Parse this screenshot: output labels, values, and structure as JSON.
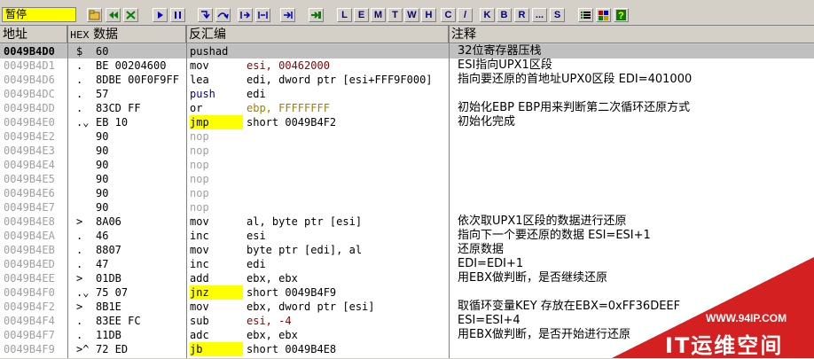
{
  "toolbar": {
    "status": "暂停",
    "letters": [
      "L",
      "E",
      "M",
      "T",
      "W",
      "H",
      "C",
      "/",
      "K",
      "B",
      "R",
      "...",
      "S"
    ]
  },
  "header": {
    "addr": "地址",
    "hex_prefix": "HEX",
    "hex": "数据",
    "disasm": "反汇编",
    "comment": "注释"
  },
  "rows": [
    {
      "addr": "0049B4D0",
      "arrow": "$",
      "hex": "60",
      "mn": "pushad",
      "op": "",
      "cm": "32位寄存器压栈",
      "sel": true
    },
    {
      "addr": "0049B4D1",
      "arrow": ".",
      "hex": "BE 00204600",
      "mn": "mov",
      "op": "esi, 00462000",
      "cm": "ESI指向UPX1区段"
    },
    {
      "addr": "0049B4D6",
      "arrow": ".",
      "hex": "8DBE 00F0F9FF",
      "mn": "lea",
      "op": "edi, dword ptr [esi+FFF9F000]",
      "cm": "指向要还原的首地址UPX0区段 EDI=401000"
    },
    {
      "addr": "0049B4DC",
      "arrow": ".",
      "hex": "57",
      "mn": "push",
      "op": "edi",
      "cm": ""
    },
    {
      "addr": "0049B4DD",
      "arrow": ".",
      "hex": "83CD FF",
      "mn": "or",
      "op": "ebp, FFFFFFFF",
      "cm": "初始化EBP EBP用来判断第二次循环还原方式"
    },
    {
      "addr": "0049B4E0",
      "arrow": ".⌄",
      "hex": "EB 10",
      "mn": "jmp",
      "op": "short 0049B4F2",
      "cm": "初始化完成"
    },
    {
      "addr": "0049B4E2",
      "arrow": "",
      "hex": "90",
      "mn": "nop",
      "op": "",
      "cm": ""
    },
    {
      "addr": "0049B4E3",
      "arrow": "",
      "hex": "90",
      "mn": "nop",
      "op": "",
      "cm": ""
    },
    {
      "addr": "0049B4E4",
      "arrow": "",
      "hex": "90",
      "mn": "nop",
      "op": "",
      "cm": ""
    },
    {
      "addr": "0049B4E5",
      "arrow": "",
      "hex": "90",
      "mn": "nop",
      "op": "",
      "cm": ""
    },
    {
      "addr": "0049B4E6",
      "arrow": "",
      "hex": "90",
      "mn": "nop",
      "op": "",
      "cm": ""
    },
    {
      "addr": "0049B4E7",
      "arrow": "",
      "hex": "90",
      "mn": "nop",
      "op": "",
      "cm": ""
    },
    {
      "addr": "0049B4E8",
      "arrow": ">",
      "hex": "8A06",
      "mn": "mov",
      "op": "al, byte ptr [esi]",
      "cm": "依次取UPX1区段的数据进行还原"
    },
    {
      "addr": "0049B4EA",
      "arrow": ".",
      "hex": "46",
      "mn": "inc",
      "op": "esi",
      "cm": "指向下一个要还原的数据 ESI=ESI+1"
    },
    {
      "addr": "0049B4EB",
      "arrow": ".",
      "hex": "8807",
      "mn": "mov",
      "op": "byte ptr [edi], al",
      "cm": "还原数据"
    },
    {
      "addr": "0049B4ED",
      "arrow": ".",
      "hex": "47",
      "mn": "inc",
      "op": "edi",
      "cm": "EDI=EDI+1"
    },
    {
      "addr": "0049B4EE",
      "arrow": ">",
      "hex": "01DB",
      "mn": "add",
      "op": "ebx, ebx",
      "cm": "用EBX做判断，是否继续还原"
    },
    {
      "addr": "0049B4F0",
      "arrow": ".⌄",
      "hex": "75 07",
      "mn": "jnz",
      "op": "short 0049B4F9",
      "cm": ""
    },
    {
      "addr": "0049B4F2",
      "arrow": ">",
      "hex": "8B1E",
      "mn": "mov",
      "op": "ebx, dword ptr [esi]",
      "cm": "取循环变量KEY 存放在EBX=0xFF36DEEF"
    },
    {
      "addr": "0049B4F4",
      "arrow": ".",
      "hex": "83EE FC",
      "mn": "sub",
      "op": "esi, -4",
      "cm": "ESI=ESI+4"
    },
    {
      "addr": "0049B4F7",
      "arrow": ".",
      "hex": "11DB",
      "mn": "adc",
      "op": "ebx, ebx",
      "cm": "用EBX做判断，是否开始进行还原"
    },
    {
      "addr": "0049B4F9",
      "arrow": ">^",
      "hex": "72 ED",
      "mn": "jb",
      "op": "short 0049B4E8",
      "cm": ""
    }
  ],
  "watermark": {
    "url": "WWW.94IP.COM",
    "brand": "IT运维空间"
  }
}
